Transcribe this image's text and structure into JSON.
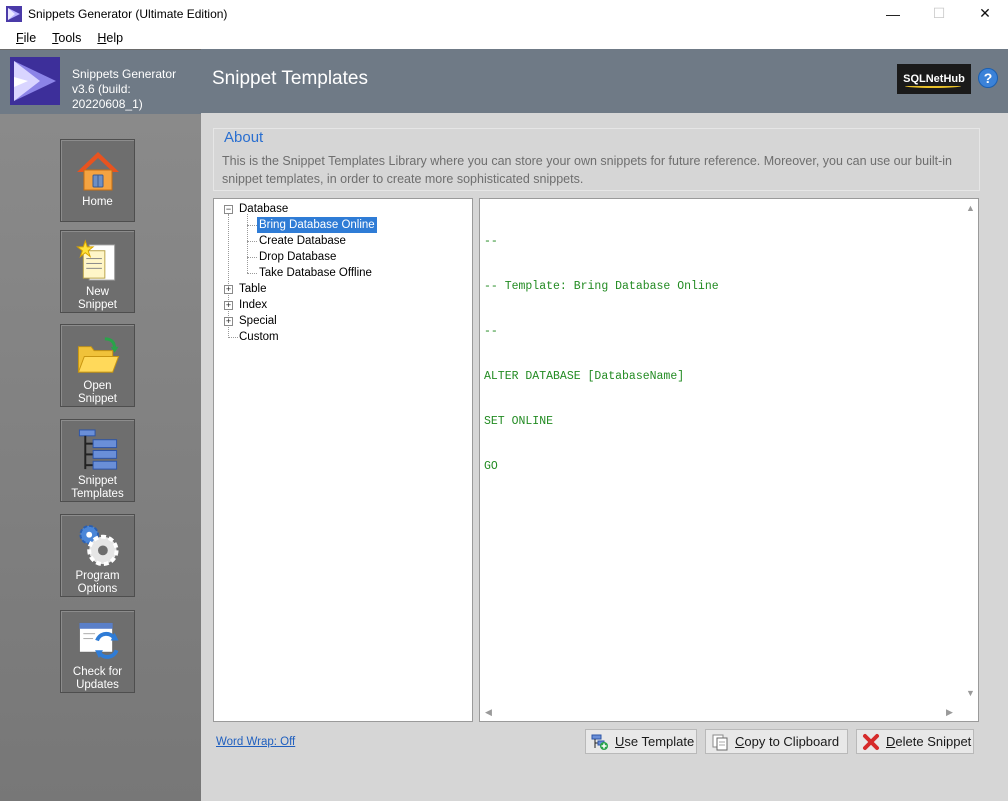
{
  "window": {
    "title": "Snippets Generator (Ultimate Edition)",
    "minimize": "—",
    "maximize": "☐",
    "close": "✕"
  },
  "menu": {
    "file_key": "F",
    "file_rest": "ile",
    "tools_key": "T",
    "tools_rest": "ools",
    "help_key": "H",
    "help_rest": "elp"
  },
  "app": {
    "name": "Snippets Generator",
    "version": "v3.6 (build: 20220608_1)"
  },
  "nav": [
    {
      "label": "Home",
      "icon": "home-icon"
    },
    {
      "label": "New\nSnippet",
      "icon": "new-snippet-icon"
    },
    {
      "label": "Open\nSnippet",
      "icon": "open-folder-icon"
    },
    {
      "label": "Snippet\nTemplates",
      "icon": "tree-list-icon"
    },
    {
      "label": "Program\nOptions",
      "icon": "gears-icon"
    },
    {
      "label": "Check for\nUpdates",
      "icon": "updates-icon"
    }
  ],
  "header": {
    "title": "Snippet Templates",
    "brand": "SQLNetHub",
    "help": "?"
  },
  "about": {
    "title": "About",
    "text": "This is the Snippet Templates Library where you can store your own snippets for future reference. Moreover, you can use our built-in snippet templates, in order to create more sophisticated snippets."
  },
  "tree": {
    "database": "Database",
    "database_children": [
      "Bring Database Online",
      "Create Database",
      "Drop Database",
      "Take Database Offline"
    ],
    "table": "Table",
    "index": "Index",
    "special": "Special",
    "custom": "Custom",
    "selected": "Bring Database Online"
  },
  "editor": {
    "lines": [
      "--",
      "-- Template: Bring Database Online",
      "--",
      "ALTER DATABASE [DatabaseName]",
      "SET ONLINE",
      "GO"
    ]
  },
  "footer": {
    "word_wrap": "Word Wrap: Off",
    "use_template_key": "U",
    "use_template_rest": "se Template",
    "copy_key": "C",
    "copy_rest": "opy to Clipboard",
    "delete_key": "D",
    "delete_rest": "elete Snippet"
  },
  "colors": {
    "header_bg": "#6f7a86",
    "accent": "#2a6fd0",
    "code_green": "#228b22",
    "selection": "#2f7cd6"
  }
}
